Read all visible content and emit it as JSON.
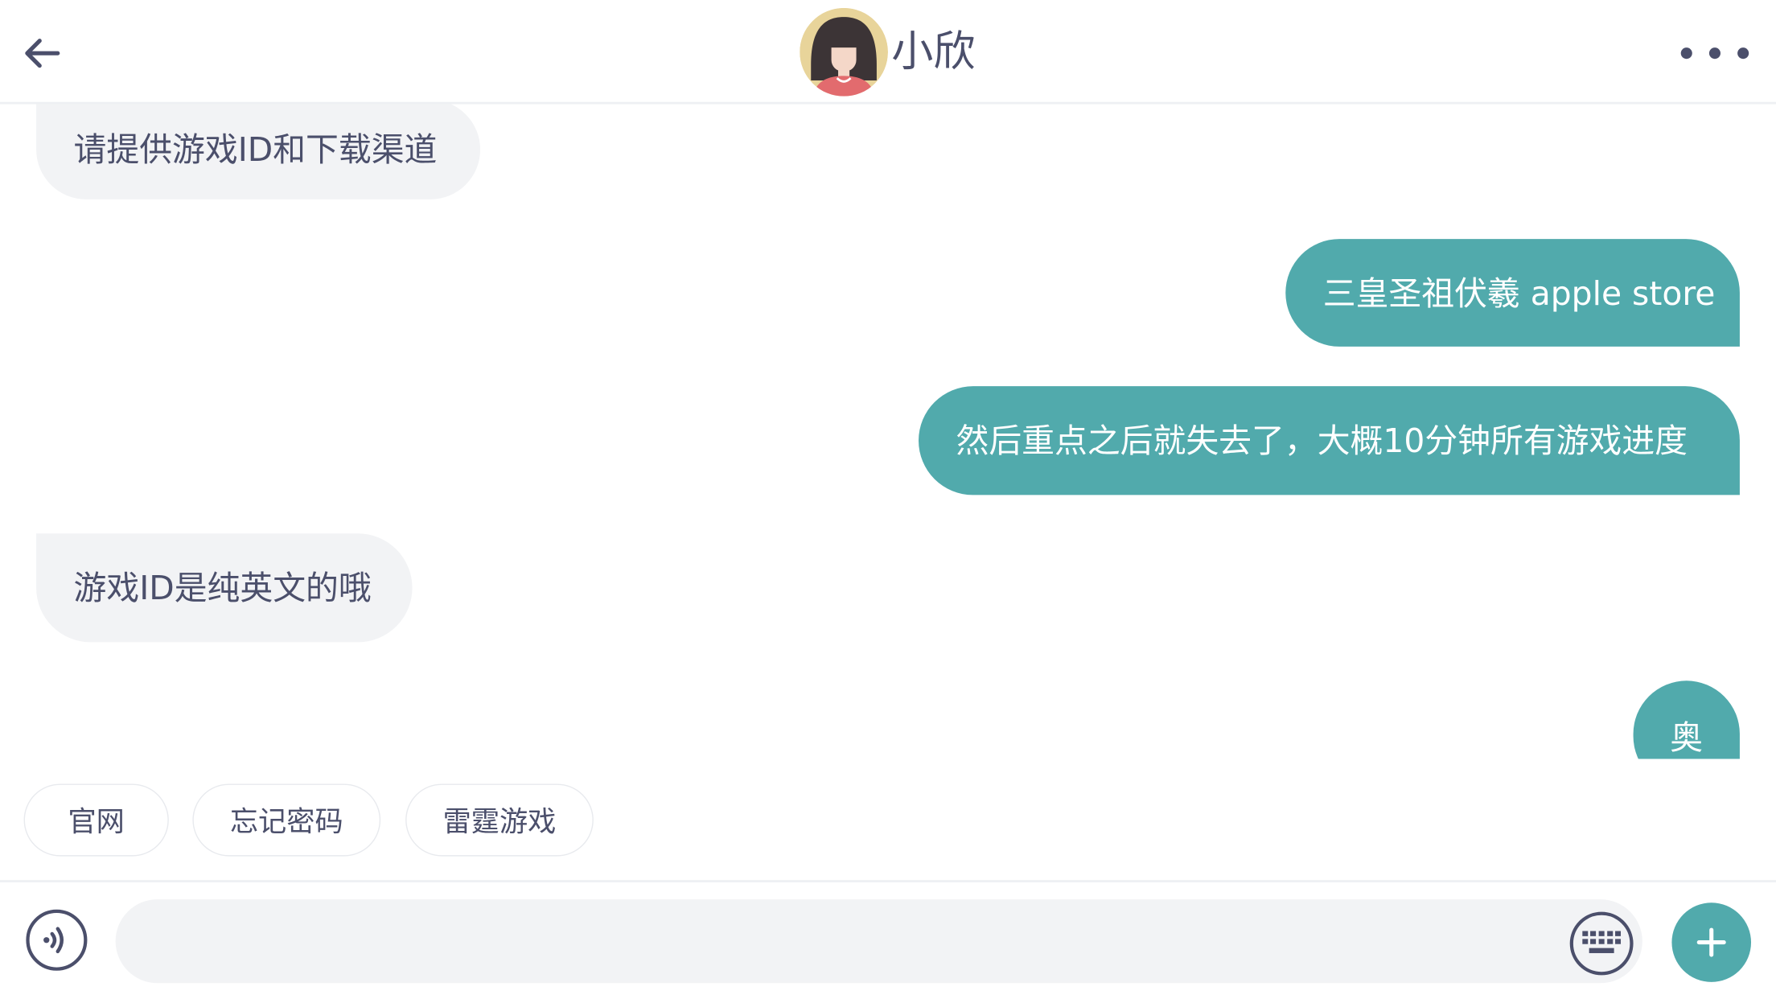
{
  "header": {
    "title": "小欣",
    "back_icon": "arrow-left-icon",
    "more_icon": "ellipsis-icon"
  },
  "messages": [
    {
      "from": "agent",
      "text": "请提供游戏ID和下载渠道"
    },
    {
      "from": "user",
      "text": "三皇圣祖伏羲 apple store"
    },
    {
      "from": "user",
      "text": "然后重点之后就失去了，大概10分钟所有游戏进度"
    },
    {
      "from": "agent",
      "text": "游戏ID是纯英文的哦"
    },
    {
      "from": "user",
      "text": "奥"
    }
  ],
  "quick_replies": [
    "官网",
    "忘记密码",
    "雷霆游戏"
  ],
  "input": {
    "value": "",
    "placeholder": ""
  },
  "icons": {
    "voice": "voice-wave-icon",
    "keyboard": "keyboard-icon",
    "plus": "plus-icon"
  },
  "colors": {
    "accent": "#51aaac",
    "incoming_bubble": "#f2f3f5",
    "text": "#4b4f6b"
  }
}
